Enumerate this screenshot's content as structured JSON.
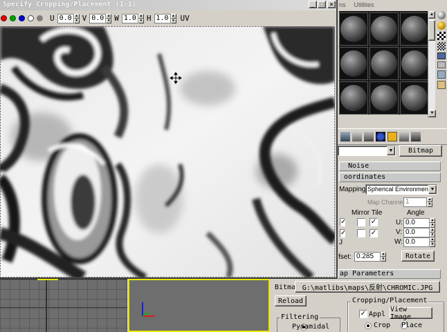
{
  "window": {
    "title": "Specify Cropping/Placement (1:1)",
    "controls": [
      "minimize-icon",
      "maximize-icon",
      "close-icon"
    ]
  },
  "toolbar": {
    "channel_colors": [
      "#e00000",
      "#00a000",
      "#0000d0",
      "#ffffff",
      "#808080"
    ],
    "u_label": "U",
    "u_value": "0.0",
    "v_label": "V",
    "v_value": "0.0",
    "w_label": "W",
    "w_value": "1.0",
    "h_label": "H",
    "h_value": "1.0",
    "uv_label": "UV"
  },
  "menubar": {
    "items": [
      "ns",
      "Utilities"
    ]
  },
  "material_editor": {
    "slots_rows": 3,
    "slots_cols": 3,
    "map_type_button": "Bitmap",
    "noise_rollout": "Noise",
    "coordinates_rollout": "oordinates",
    "mapping_label": "Mapping:",
    "mapping_value": "Spherical Environment",
    "map_channel_label": "Map Channel:",
    "map_channel_value": "1",
    "mirror_tile_label": "Mirror Tile",
    "angle_label": "Angle",
    "u_label": "U:",
    "u_angle": "0.0",
    "v_label": "V:",
    "v_angle": "0.0",
    "w_label": "W:",
    "w_angle": "0.0",
    "blur_offset_label": "fset:",
    "blur_offset_value": "0.285",
    "rotate_button": "Rotate",
    "map_params_rollout": "ap Parameters",
    "bitmap_label": "Bitmap:",
    "bitmap_path": "G:\\matlibs\\maps\\反射\\CHROMIC.JPG",
    "reload_button": "Reload",
    "cropping_group": "Cropping/Placement",
    "apply_label": "Appl",
    "view_image_button": "View Image",
    "crop_label": "Crop",
    "place_label": "Place",
    "filtering_group": "Filtering",
    "pyramidal_label": "Pyramidal"
  },
  "colors": {
    "title_active": "#0a246a",
    "title_inactive": "#808080",
    "face": "#d4d0c8",
    "viewport_gray": "#6e6e6e",
    "viewport_active_border": "#e8e800"
  }
}
